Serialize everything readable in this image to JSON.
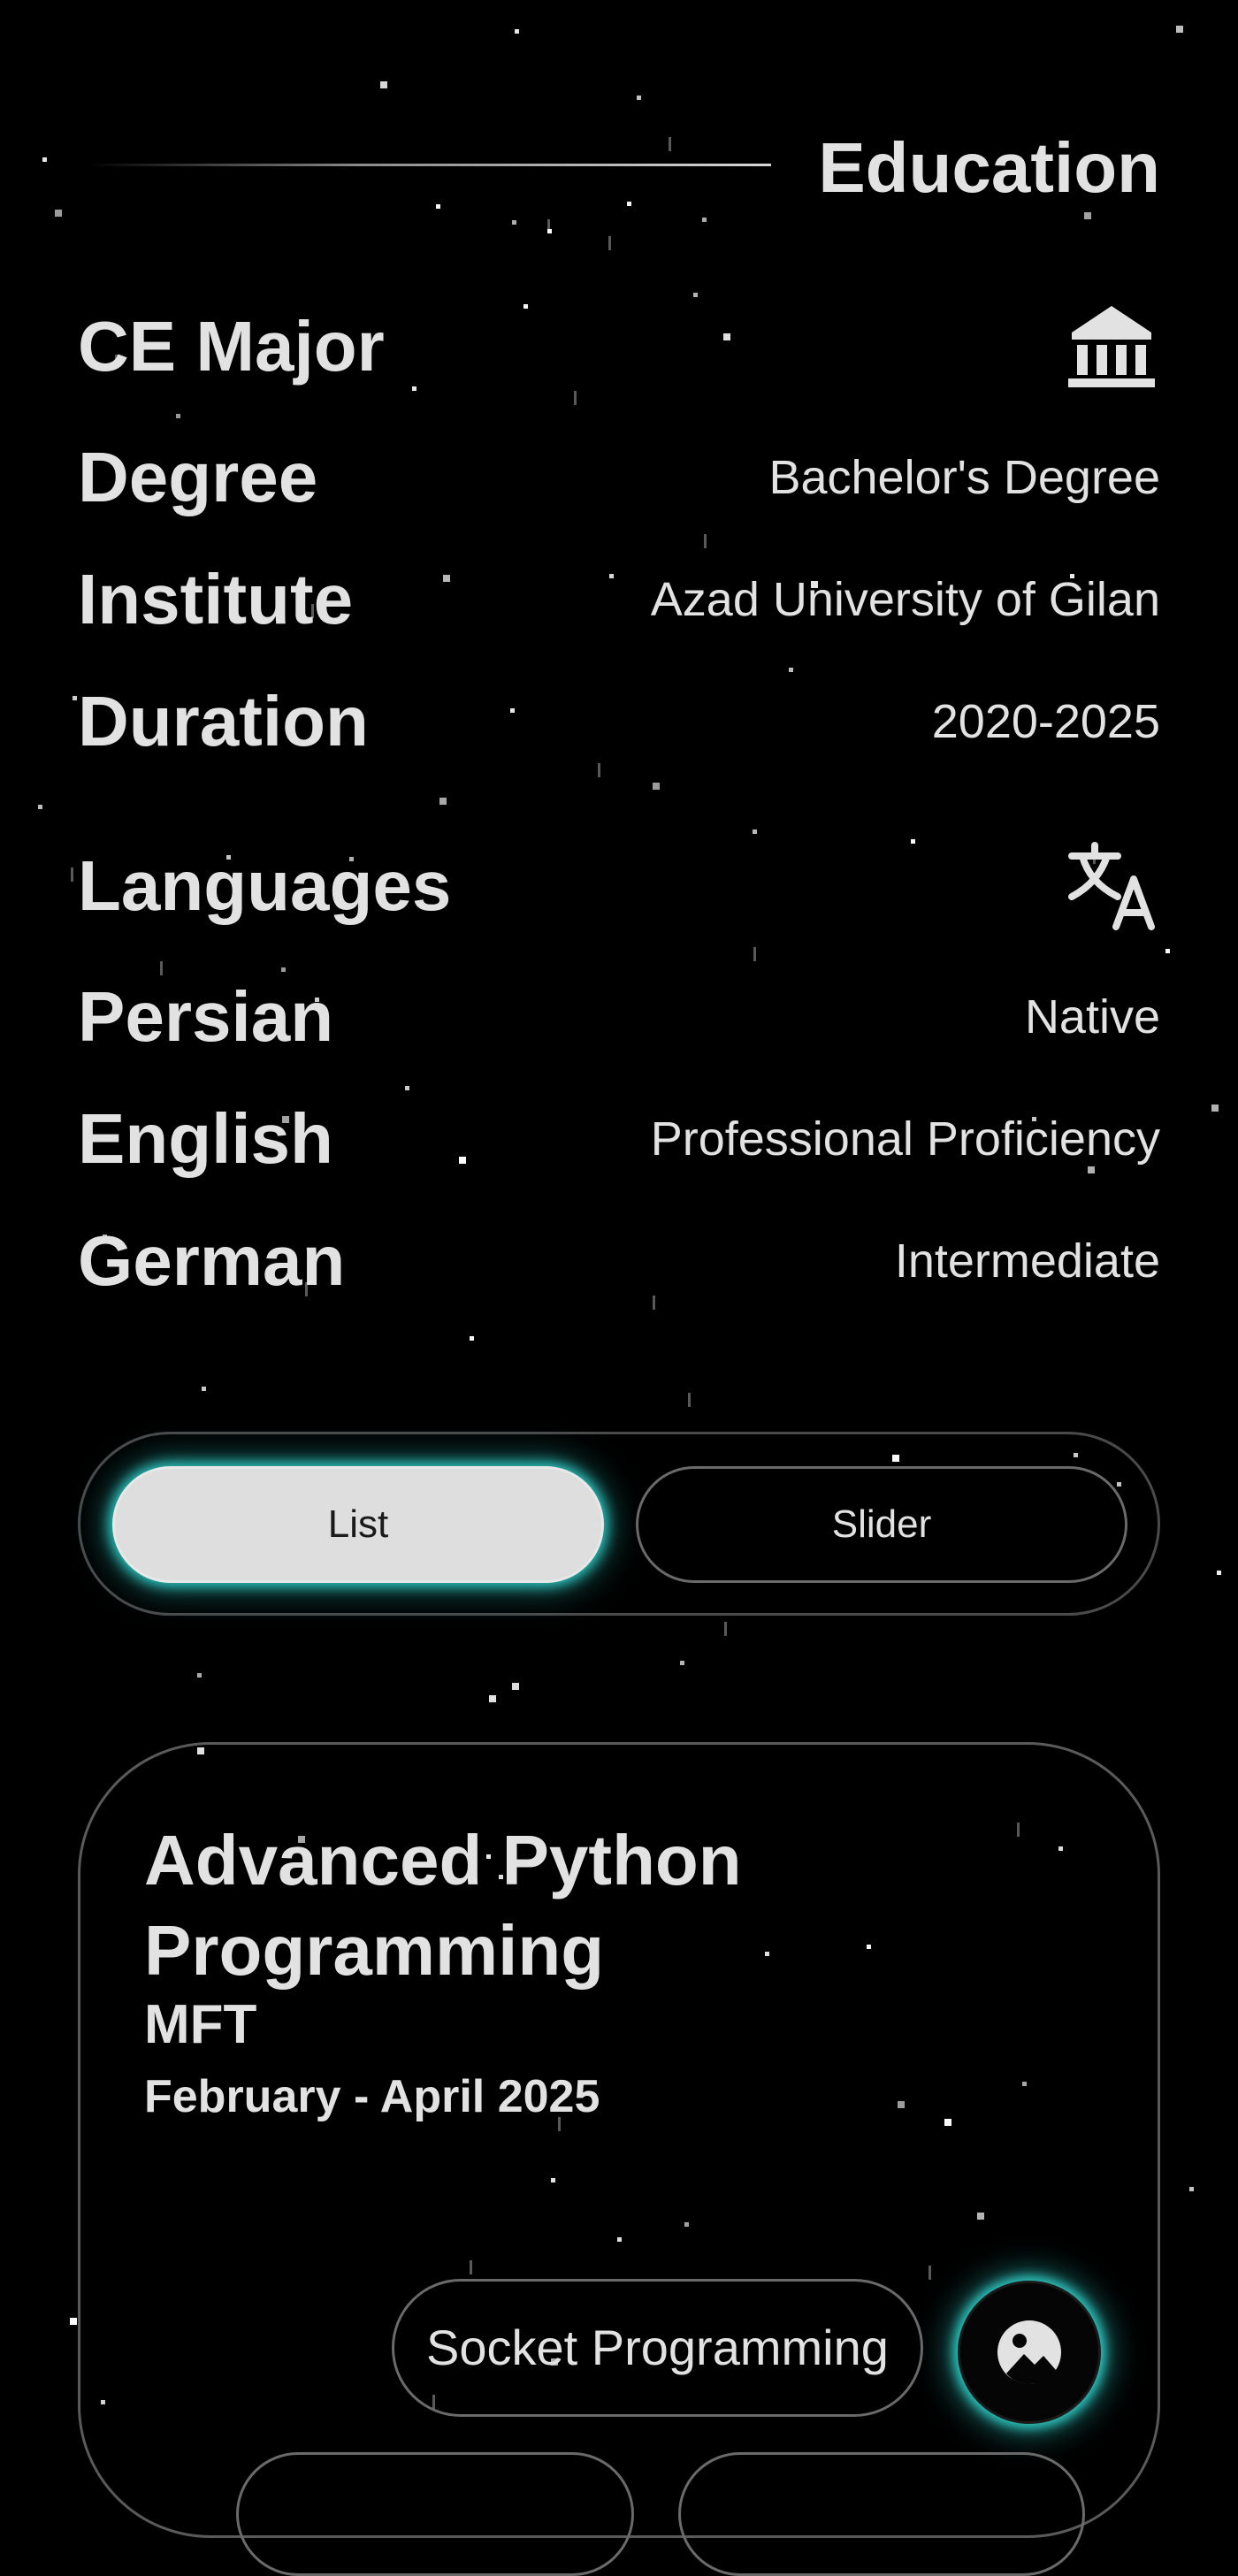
{
  "education": {
    "title": "Education",
    "major": {
      "heading": "CE Major",
      "icon": "institution-icon",
      "rows": [
        {
          "label": "Degree",
          "value": "Bachelor's Degree"
        },
        {
          "label": "Institute",
          "value": "Azad University of Gilan"
        },
        {
          "label": "Duration",
          "value": "2020-2025"
        }
      ]
    },
    "languages": {
      "heading": "Languages",
      "icon": "translate-icon",
      "rows": [
        {
          "label": "Persian",
          "value": "Native"
        },
        {
          "label": "English",
          "value": "Professional Proficiency"
        },
        {
          "label": "German",
          "value": "Intermediate"
        }
      ]
    }
  },
  "view_toggle": {
    "options": [
      "List",
      "Slider"
    ],
    "selected": "List"
  },
  "course_card": {
    "title": "Advanced Python Programming",
    "provider": "MFT",
    "dates": "February - April 2025",
    "tags": [
      "Socket Programming"
    ],
    "image_button_icon": "image-icon"
  },
  "colors": {
    "background": "#000000",
    "text": "#e2e2e2",
    "accent_glow": "#2fc7c1",
    "border": "#5a5a5a"
  }
}
